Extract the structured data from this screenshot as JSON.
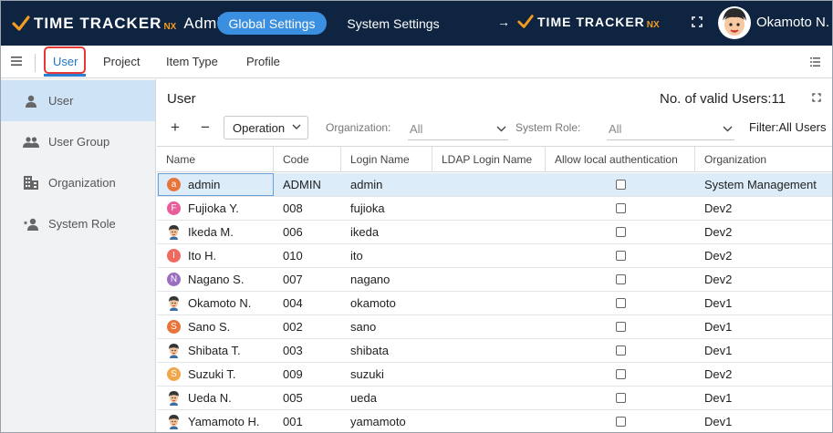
{
  "header": {
    "logo_text": "TIME TRACKER",
    "logo_suffix": "NX",
    "app_title": "Admin",
    "global_settings": "Global Settings",
    "system_settings": "System Settings",
    "arrow": "→",
    "user_name": "Okamoto N."
  },
  "nav": {
    "tabs": [
      {
        "label": "User"
      },
      {
        "label": "Project"
      },
      {
        "label": "Item Type"
      },
      {
        "label": "Profile"
      }
    ]
  },
  "sidebar": {
    "items": [
      {
        "label": "User",
        "icon": "person-icon"
      },
      {
        "label": "User Group",
        "icon": "people-icon"
      },
      {
        "label": "Organization",
        "icon": "building-icon"
      },
      {
        "label": "System Role",
        "icon": "person-star-icon"
      }
    ]
  },
  "main": {
    "title": "User",
    "valid_users": "No. of valid Users:11",
    "toolbar": {
      "plus": "+",
      "minus": "−",
      "operation": "Operation",
      "org_label": "Organization:",
      "org_value": "All",
      "role_label": "System Role:",
      "role_value": "All",
      "filter": "Filter:All Users"
    },
    "columns": [
      "Name",
      "Code",
      "Login Name",
      "LDAP Login Name",
      "Allow local authentication",
      "Organization"
    ],
    "rows": [
      {
        "name": "admin",
        "code": "ADMIN",
        "login": "admin",
        "ldap": "",
        "org": "System Management",
        "avatar": "a",
        "color": "#e8743b"
      },
      {
        "name": "Fujioka Y.",
        "code": "008",
        "login": "fujioka",
        "ldap": "",
        "org": "Dev2",
        "avatar": "F",
        "color": "#e85d9a"
      },
      {
        "name": "Ikeda M.",
        "code": "006",
        "login": "ikeda",
        "ldap": "",
        "org": "Dev2",
        "avatar": "",
        "color": "photo"
      },
      {
        "name": "Ito H.",
        "code": "010",
        "login": "ito",
        "ldap": "",
        "org": "Dev2",
        "avatar": "I",
        "color": "#ef6b5f"
      },
      {
        "name": "Nagano S.",
        "code": "007",
        "login": "nagano",
        "ldap": "",
        "org": "Dev2",
        "avatar": "N",
        "color": "#9a6fc1"
      },
      {
        "name": "Okamoto N.",
        "code": "004",
        "login": "okamoto",
        "ldap": "",
        "org": "Dev1",
        "avatar": "",
        "color": "photo"
      },
      {
        "name": "Sano S.",
        "code": "002",
        "login": "sano",
        "ldap": "",
        "org": "Dev1",
        "avatar": "S",
        "color": "#e8743b"
      },
      {
        "name": "Shibata T.",
        "code": "003",
        "login": "shibata",
        "ldap": "",
        "org": "Dev1",
        "avatar": "",
        "color": "photo"
      },
      {
        "name": "Suzuki T.",
        "code": "009",
        "login": "suzuki",
        "ldap": "",
        "org": "Dev2",
        "avatar": "S",
        "color": "#f0a64a"
      },
      {
        "name": "Ueda N.",
        "code": "005",
        "login": "ueda",
        "ldap": "",
        "org": "Dev1",
        "avatar": "",
        "color": "photo"
      },
      {
        "name": "Yamamoto H.",
        "code": "001",
        "login": "yamamoto",
        "ldap": "",
        "org": "Dev1",
        "avatar": "",
        "color": "photo"
      }
    ]
  }
}
